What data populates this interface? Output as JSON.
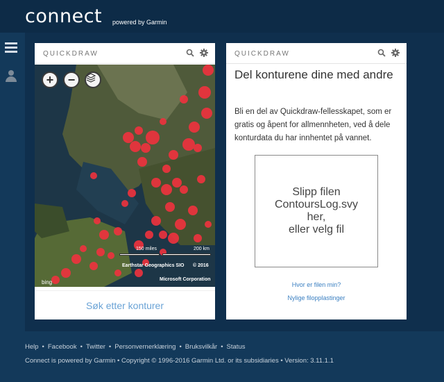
{
  "header": {
    "logo": "connect",
    "powered": "powered by Garmin"
  },
  "rail": {
    "items": [
      "menu-icon",
      "user-icon"
    ]
  },
  "map_card": {
    "title": "QUICKDRAW",
    "zoom_in": "+",
    "zoom_out": "−",
    "scale_miles": "150 miles",
    "scale_km": "200 km",
    "attribution_1": "Earthstar Geographics SIO",
    "attribution_2": "© 2016",
    "attribution_3": "Microsoft Corporation",
    "bing": "bing",
    "search_link": "Søk etter konturer"
  },
  "upload_card": {
    "title": "QUICKDRAW",
    "heading": "Del konturene dine med andre",
    "description": "Bli en del av Quickdraw-fellesskapet, som er gratis og åpent for allmennheten, ved å dele konturdata du har innhentet på vannet.",
    "drop_line1": "Slipp filen",
    "drop_line2": "ContoursLog.svy",
    "drop_line3": "her,",
    "drop_line4": "eller velg fil",
    "help_link": "Hvor er filen min?",
    "recent_link": "Nylige filopplastinger"
  },
  "footer": {
    "links": [
      "Help",
      "Facebook",
      "Twitter",
      "Personvernerklæring",
      "Bruksvilkår",
      "Status"
    ],
    "copyright": "Connect is powered by Garmin • Copyright © 1996-2016 Garmin Ltd. or its subsidiaries • Version: 3.11.1.1"
  },
  "colors": {
    "accent": "#3a7fc1",
    "header_bg": "#0d2b47",
    "page_bg": "#13395a",
    "marker": "#f0323e"
  }
}
